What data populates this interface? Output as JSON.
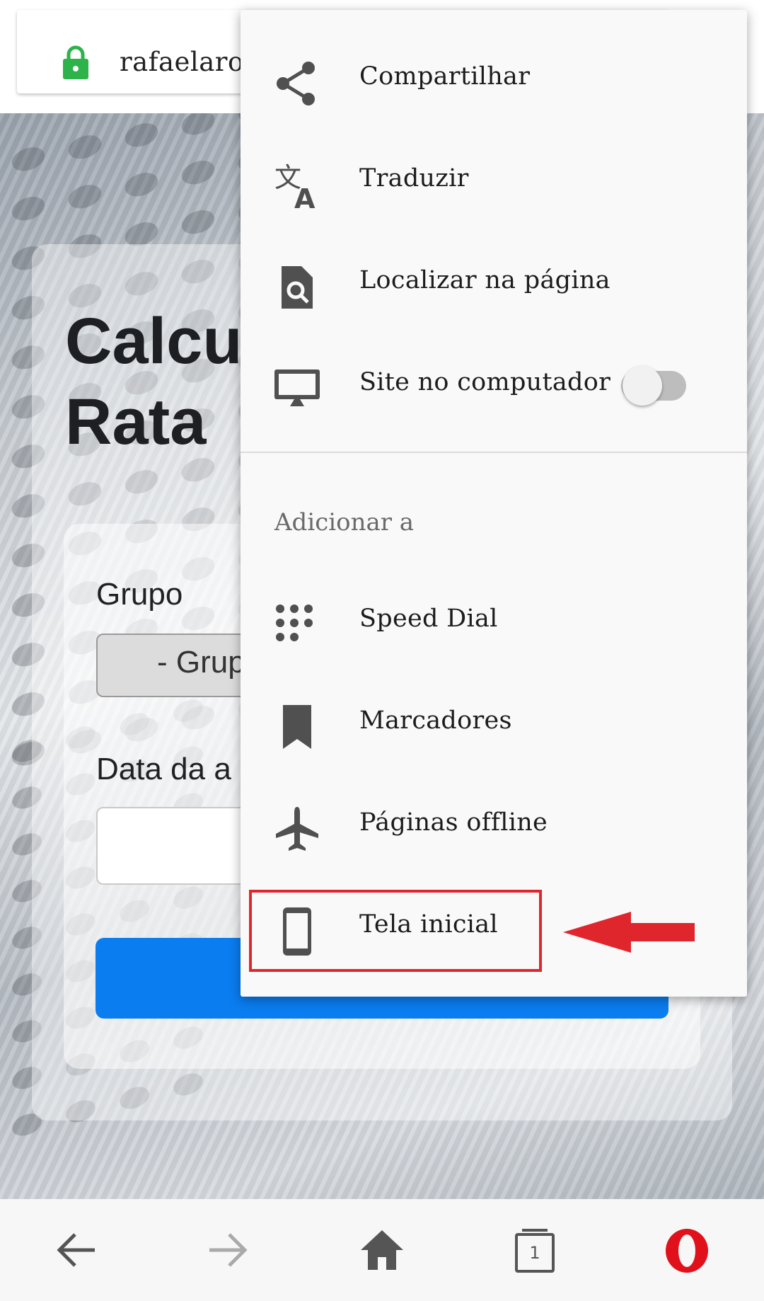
{
  "address_bar": {
    "url": "rafaelarodri"
  },
  "page": {
    "title": "Calcul\nRata",
    "group_label": "Grupo",
    "group_select_value": "- Grup",
    "date_label": "Data da a"
  },
  "menu": {
    "items": [
      {
        "label": "Compartilhar",
        "icon": "share-icon"
      },
      {
        "label": "Traduzir",
        "icon": "translate-icon"
      },
      {
        "label": "Localizar na página",
        "icon": "find-in-page-icon"
      },
      {
        "label": "Site no computador",
        "icon": "desktop-icon",
        "toggle": false
      }
    ],
    "section_header": "Adicionar a",
    "add_items": [
      {
        "label": "Speed Dial",
        "icon": "speed-dial-icon"
      },
      {
        "label": "Marcadores",
        "icon": "bookmark-icon"
      },
      {
        "label": "Páginas offline",
        "icon": "airplane-icon"
      },
      {
        "label": "Tela inicial",
        "icon": "phone-icon",
        "highlighted": true
      }
    ]
  },
  "bottom_bar": {
    "tab_count": "1",
    "buttons": [
      "back-icon",
      "forward-icon",
      "home-icon",
      "tabs-icon",
      "opera-menu-icon"
    ]
  },
  "colors": {
    "accent_blue": "#0a7df0",
    "lock_green": "#2db34a",
    "highlight_red": "#e0262d",
    "opera_red": "#e0111b",
    "icon_gray": "#505050"
  }
}
